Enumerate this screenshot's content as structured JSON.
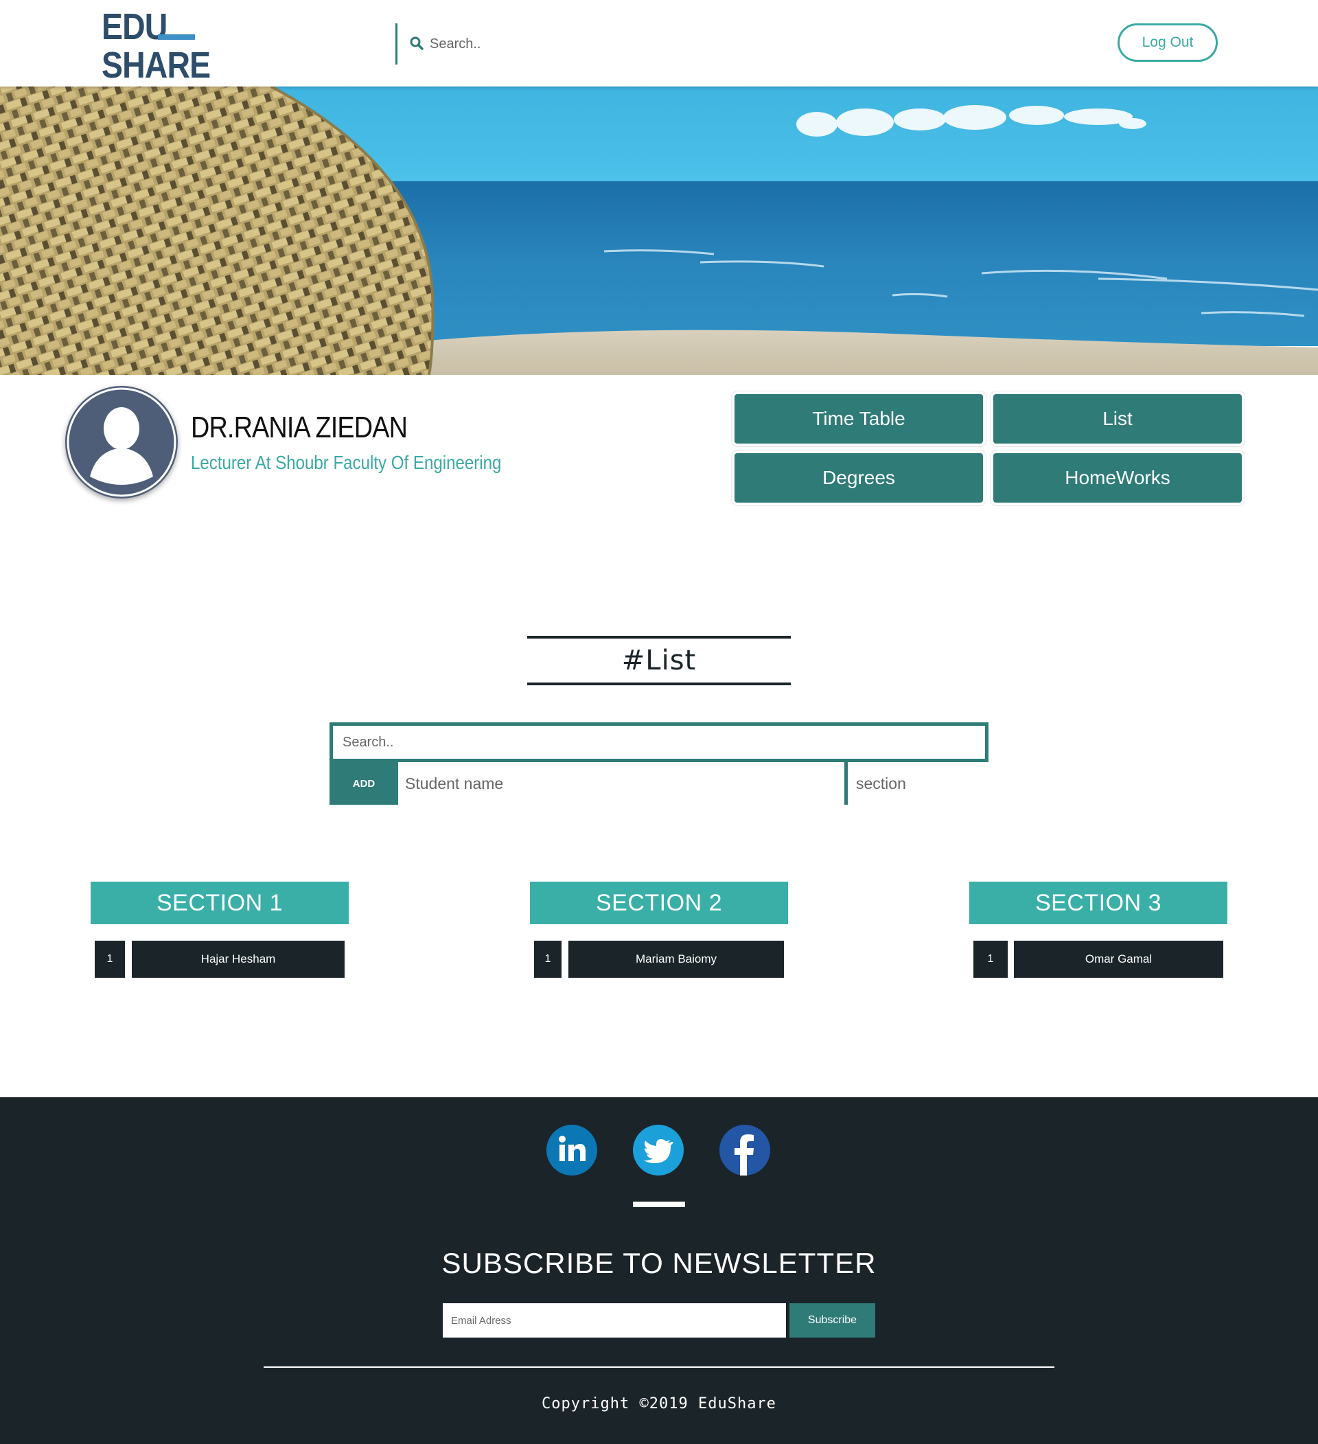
{
  "header": {
    "logo_line1": "EDU",
    "logo_line2": "SHARE",
    "search_placeholder": "Search..",
    "logout_label": "Log Out"
  },
  "profile": {
    "name": "DR.RANIA ZIEDAN",
    "subtitle": "Lecturer At Shoubr Faculty Of Engineering",
    "nav": [
      "Time Table",
      "List",
      "Degrees",
      "HomeWorks"
    ]
  },
  "list": {
    "title": "#List",
    "search_placeholder": "Search..",
    "add_label": "ADD",
    "student_placeholder": "Student name",
    "section_placeholder": "section",
    "sections": [
      {
        "title": "SECTION 1",
        "rows": [
          {
            "num": "1",
            "name": "Hajar Hesham"
          }
        ]
      },
      {
        "title": "SECTION 2",
        "rows": [
          {
            "num": "1",
            "name": "Mariam Baiomy"
          }
        ]
      },
      {
        "title": "SECTION 3",
        "rows": [
          {
            "num": "1",
            "name": "Omar Gamal"
          }
        ]
      }
    ]
  },
  "footer": {
    "social_icons": [
      "linkedin-icon",
      "twitter-icon",
      "facebook-icon"
    ],
    "newsletter_title": "SUBSCRIBE TO NEWSLETTER",
    "email_placeholder": "Email Adress",
    "subscribe_label": "Subscribe",
    "copyright": "Copyright ©2019 EduShare"
  },
  "colors": {
    "primary": "#2e7b78",
    "accent": "#3aafa8",
    "dark": "#1b2429",
    "logo": "#2e4d6b"
  }
}
